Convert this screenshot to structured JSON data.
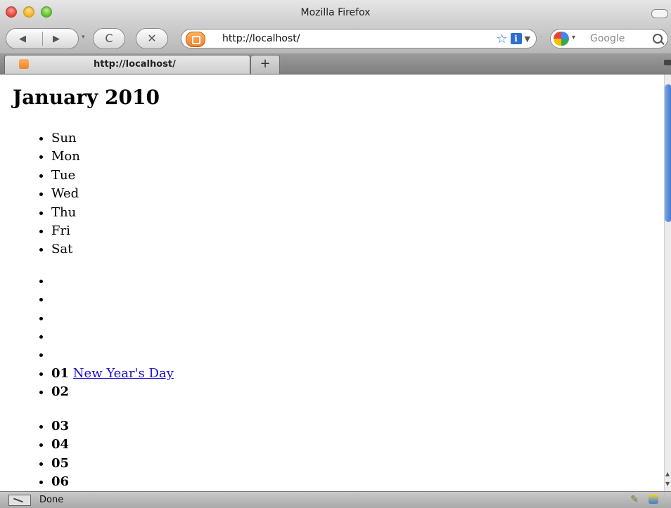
{
  "window": {
    "title": "Mozilla Firefox"
  },
  "toolbar": {
    "back_glyph": "◀",
    "forward_glyph": "▶",
    "reload_glyph": "C",
    "stop_glyph": "✕",
    "url": "http://localhost/",
    "search_placeholder": "Google",
    "bookmark_glyph": "☆",
    "info_glyph": "i",
    "url_dropdown_glyph": "▼"
  },
  "tabs": [
    {
      "label": "http://localhost/"
    }
  ],
  "newtab_glyph": "+",
  "page": {
    "heading": "January 2010",
    "days": [
      "Sun",
      "Mon",
      "Tue",
      "Wed",
      "Thu",
      "Fri",
      "Sat"
    ],
    "cells": [
      {
        "day": "",
        "event": ""
      },
      {
        "day": "",
        "event": ""
      },
      {
        "day": "",
        "event": ""
      },
      {
        "day": "",
        "event": ""
      },
      {
        "day": "",
        "event": ""
      },
      {
        "day": "01",
        "event": "New Year's Day"
      },
      {
        "day": "02",
        "event": ""
      },
      {
        "day": "03",
        "event": ""
      },
      {
        "day": "04",
        "event": ""
      },
      {
        "day": "05",
        "event": ""
      },
      {
        "day": "06",
        "event": ""
      }
    ]
  },
  "status": {
    "text": "Done"
  },
  "icons": {
    "site": "xampp-site-icon",
    "search_engine": "google-icon",
    "search": "magnifier-icon",
    "status_left": "cancel-icon",
    "status_right_1": "addon-icon",
    "status_right_2": "addon-icon"
  },
  "colors": {
    "link": "#1a0dcd",
    "scroll_thumb": "#3f76cc"
  }
}
